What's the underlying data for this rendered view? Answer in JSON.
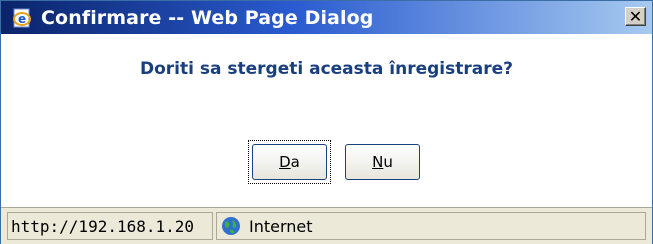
{
  "window": {
    "title": "Confirmare -- Web Page Dialog",
    "icon": "ie-page-icon",
    "close_label": "✕"
  },
  "dialog": {
    "message": "Doriti sa stergeti aceasta înregistrare?"
  },
  "buttons": {
    "yes": {
      "accel": "D",
      "rest": "a"
    },
    "no": {
      "accel": "N",
      "rest": "u"
    }
  },
  "statusbar": {
    "url": "http://192.168.1.20",
    "zone": "Internet",
    "zone_icon": "globe-icon"
  },
  "colors": {
    "title_gradient_start": "#0a246a",
    "title_gradient_end": "#a6caf0",
    "message_text": "#1a3f80",
    "button_border": "#1c3f7d"
  }
}
